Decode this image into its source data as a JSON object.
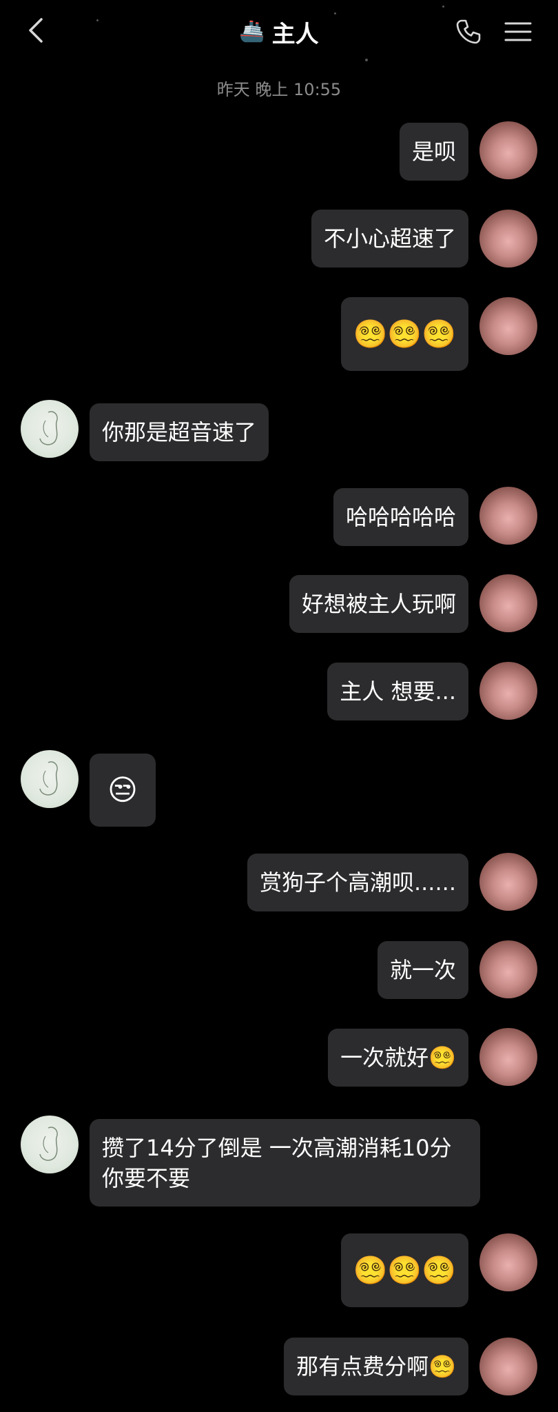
{
  "header": {
    "title": "主人",
    "title_icon": "🚢",
    "back_icon": "chevron-left-icon",
    "call_icon": "phone-icon",
    "menu_icon": "menu-icon"
  },
  "timestamp": "昨天 晚上 10:55",
  "colors": {
    "background": "#000000",
    "bubble": "#2c2c2e",
    "text": "#ffffff",
    "timestamp": "#8c8c8c"
  },
  "messages": [
    {
      "sender": "me",
      "text": "是呗"
    },
    {
      "sender": "me",
      "text": "不小心超速了"
    },
    {
      "sender": "me",
      "text": "😵‍💫😵‍💫😵‍💫"
    },
    {
      "sender": "other",
      "text": "你那是超音速了"
    },
    {
      "sender": "me",
      "text": "哈哈哈哈哈"
    },
    {
      "sender": "me",
      "text": "好想被主人玩啊"
    },
    {
      "sender": "me",
      "text": "主人 想要..."
    },
    {
      "sender": "other",
      "text": "😒"
    },
    {
      "sender": "me",
      "text": "赏狗子个高潮呗......"
    },
    {
      "sender": "me",
      "text": "就一次"
    },
    {
      "sender": "me",
      "text": "一次就好😵‍💫"
    },
    {
      "sender": "other",
      "text": "攒了14分了倒是 一次高潮消耗10分 你要不要"
    },
    {
      "sender": "me",
      "text": "😵‍💫😵‍💫😵‍💫"
    },
    {
      "sender": "me",
      "text": "那有点费分啊😵‍💫"
    }
  ]
}
